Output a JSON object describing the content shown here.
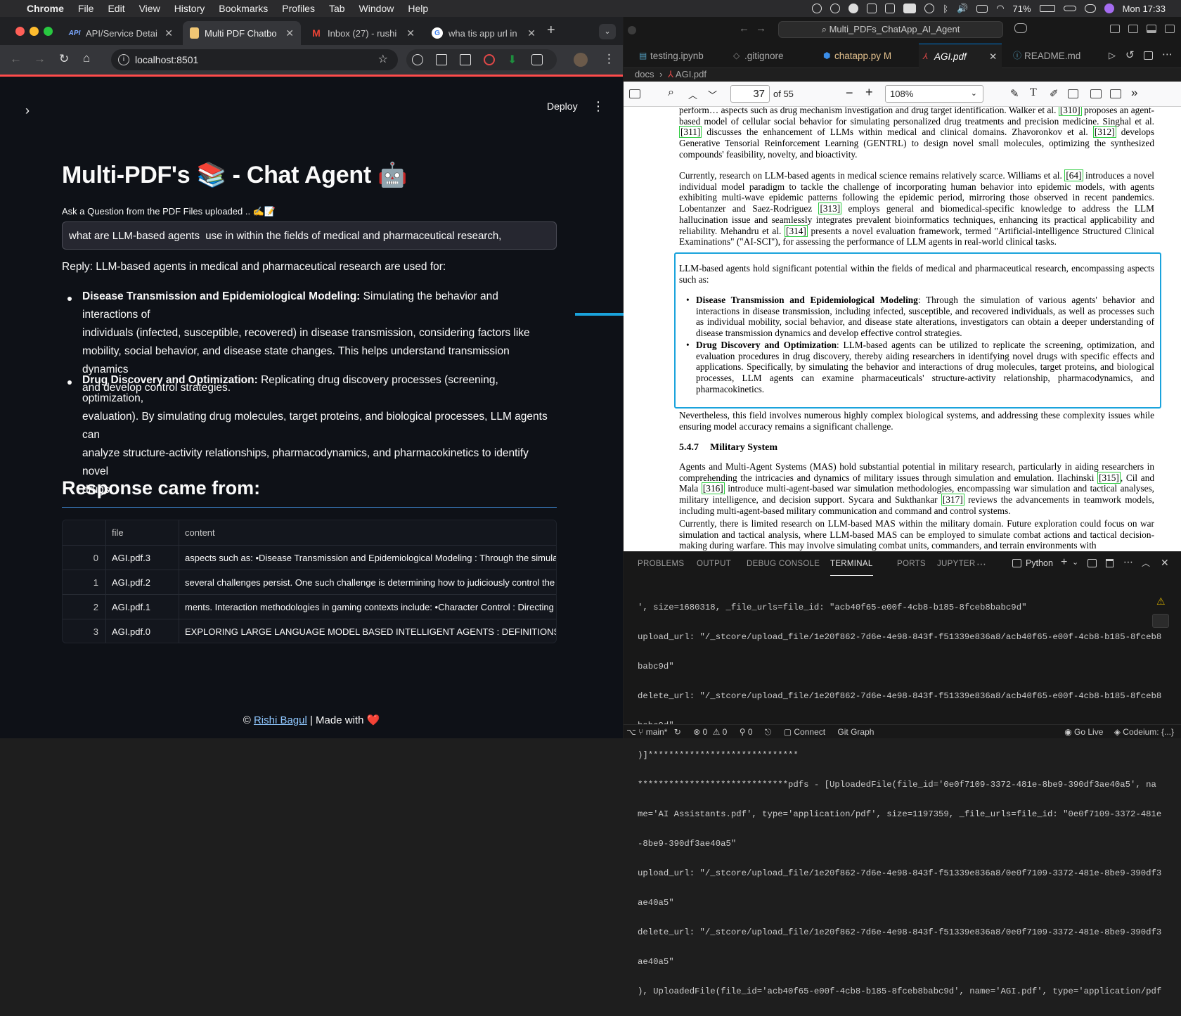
{
  "menubar": {
    "app": "Chrome",
    "items": [
      "File",
      "Edit",
      "View",
      "History",
      "Bookmarks",
      "Profiles",
      "Tab",
      "Window",
      "Help"
    ],
    "battery": "71%",
    "clock": "Mon 17:33"
  },
  "chrome": {
    "tabs": [
      {
        "title": "API/Service Detai",
        "favicon": "API"
      },
      {
        "title": "Multi PDF Chatbo",
        "favicon": "doc"
      },
      {
        "title": "Inbox (27) - rushi",
        "favicon": "M"
      },
      {
        "title": "wha tis app url in",
        "favicon": "G"
      }
    ],
    "url": "localhost:8501"
  },
  "streamlit": {
    "deploy": "Deploy",
    "title": "Multi-PDF's 📚 - Chat Agent 🤖",
    "question_label": "Ask a Question from the PDF Files uploaded .. ✍️📝",
    "question_value": "what are LLM-based agents  use in within the fields of medical and pharmaceutical research,",
    "reply_intro": "Reply: LLM-based agents in medical and pharmaceutical research are used for:",
    "bullets": [
      {
        "bold": "Disease Transmission and Epidemiological Modeling:",
        "lines": [
          "Simulating the behavior and interactions of",
          "individuals (infected, susceptible, recovered) in disease transmission, considering factors like",
          "mobility, social behavior, and disease state changes. This helps understand transmission dynamics",
          "and develop control strategies."
        ]
      },
      {
        "bold": "Drug Discovery and Optimization:",
        "lines": [
          "Replicating drug discovery processes (screening, optimization,",
          "evaluation). By simulating drug molecules, target proteins, and biological processes, LLM agents can",
          "analyze structure-activity relationships, pharmacodynamics, and pharmacokinetics to identify novel",
          "drugs."
        ]
      }
    ],
    "response_header": "Response came from:",
    "table": {
      "columns": [
        "",
        "file",
        "content"
      ],
      "rows": [
        [
          "0",
          "AGI.pdf.3",
          "aspects such as: •Disease Transmission and Epidemiological Modeling : Through the simula"
        ],
        [
          "1",
          "AGI.pdf.2",
          "several challenges persist. One such challenge is determining how to judiciously control the"
        ],
        [
          "2",
          "AGI.pdf.1",
          "ments. Interaction methodologies in gaming contexts include: •Character Control : Directing"
        ],
        [
          "3",
          "AGI.pdf.0",
          "EXPLORING LARGE LANGUAGE MODEL BASED INTELLIGENT AGENTS : DEFINITIONS , METHO"
        ]
      ]
    },
    "footer_prefix": "© ",
    "footer_link": "Rishi Bagul",
    "footer_suffix": " | Made with ❤️"
  },
  "vscode": {
    "search": "Multi_PDFs_ChatApp_AI_Agent",
    "tabs": [
      {
        "name": "testing.ipynb",
        "icon": "notebook-icon"
      },
      {
        "name": ".gitignore",
        "icon": "gitignore-icon"
      },
      {
        "name": "chatapp.py",
        "badge": "M",
        "icon": "python-icon"
      },
      {
        "name": "AGI.pdf",
        "icon": "pdf-icon"
      },
      {
        "name": "README.md",
        "icon": "info-icon"
      }
    ],
    "breadcrumb": [
      "docs",
      "AGI.pdf"
    ],
    "pdf": {
      "page": "37",
      "of": "of 55",
      "zoom": "108%"
    },
    "panel_tabs": [
      "PROBLEMS",
      "OUTPUT",
      "DEBUG CONSOLE",
      "TERMINAL",
      "PORTS",
      "JUPYTER"
    ],
    "terminal_label": "Python",
    "terminal_lines": [
      "', size=1680318, _file_urls=file_id: \"acb40f65-e00f-4cb8-b185-8fceb8babc9d\"",
      "upload_url: \"/_stcore/upload_file/1e20f862-7d6e-4e98-843f-f51339e836a8/acb40f65-e00f-4cb8-b185-8fceb8",
      "babc9d\"",
      "delete_url: \"/_stcore/upload_file/1e20f862-7d6e-4e98-843f-f51339e836a8/acb40f65-e00f-4cb8-b185-8fceb8",
      "babc9d\"",
      ")]*****************************",
      "*****************************pdfs - [UploadedFile(file_id='0e0f7109-3372-481e-8be9-390df3ae40a5', na",
      "me='AI Assistants.pdf', type='application/pdf', size=1197359, _file_urls=file_id: \"0e0f7109-3372-481e",
      "-8be9-390df3ae40a5\"",
      "upload_url: \"/_stcore/upload_file/1e20f862-7d6e-4e98-843f-f51339e836a8/0e0f7109-3372-481e-8be9-390df3",
      "ae40a5\"",
      "delete_url: \"/_stcore/upload_file/1e20f862-7d6e-4e98-843f-f51339e836a8/0e0f7109-3372-481e-8be9-390df3",
      "ae40a5\"",
      "), UploadedFile(file_id='acb40f65-e00f-4cb8-b185-8fceb8babc9d', name='AGI.pdf', type='application/pdf"
    ],
    "status": {
      "branch": "main*",
      "errors": "0",
      "warnings": "0",
      "ports": "0",
      "connect": "Connect",
      "git_graph": "Git Graph",
      "go_live": "Go Live",
      "codeium": "Codeium: {...}"
    }
  },
  "pdf_text": {
    "p1a": "aspects such as drug mechanism investigation and drug target identification. Walker et al. ",
    "r310": "[310]",
    "p1b": " proposes an agent-based model of cellular social behavior for simulating personalized drug treatments and precision medicine. Singhal et al. ",
    "r311": "[311]",
    "p1c": " discusses the enhancement of LLMs within medical and clinical domains. Zhavoronkov et al. ",
    "r312": "[312]",
    "p1d": " develops Generative Tensorial Reinforcement Learning (GENTRL) to design novel small molecules, optimizing the synthesized compounds' feasibility, novelty, and bioactivity.",
    "p2a": "Currently, research on LLM-based agents in medical science remains relatively scarce. Williams et al. ",
    "r64": "[64]",
    "p2b": " introduces a novel individual model paradigm to tackle the challenge of incorporating human behavior into epidemic models, with agents exhibiting multi-wave epidemic patterns following the epidemic period, mirroring those observed in recent pandemics. Lobentanzer and Saez-Rodriguez ",
    "r313": "[313]",
    "p2c": " employs general and biomedical-specific knowledge to address the LLM hallucination issue and seamlessly integrates prevalent bioinformatics techniques, enhancing its practical applicability and reliability. Mehandru et al. ",
    "r314": "[314]",
    "p2d": " presents a novel evaluation framework, termed \"Artificial-intelligence Structured Clinical Examinations\" (\"AI-SCI\"), for assessing the performance of LLM agents in real-world clinical tasks.",
    "p3": "LLM-based agents hold significant potential within the fields of medical and pharmaceutical research, encompassing aspects such as:",
    "b1h": "Disease Transmission and Epidemiological Modeling",
    "b1": ": Through the simulation of various agents' behavior and interactions in disease transmission, including infected, susceptible, and recovered individuals, as well as processes such as individual mobility, social behavior, and disease state alterations, investigators can obtain a deeper understanding of disease transmission dynamics and develop effective control strategies.",
    "b2h": "Drug Discovery and Optimization",
    "b2": ": LLM-based agents can be utilized to replicate the screening, optimization, and evaluation procedures in drug discovery, thereby aiding researchers in identifying novel drugs with specific effects and applications. Specifically, by simulating the behavior and interactions of drug molecules, target proteins, and biological processes, LLM agents can examine pharmaceuticals' structure-activity relationship, pharmacodynamics, and pharmacokinetics.",
    "p4": "Nevertheless, this field involves numerous highly complex biological systems, and addressing these complexity issues while ensuring model accuracy remains a significant challenge.",
    "h_num": "5.4.7",
    "h_title": "Military System",
    "p5a": "Agents and Multi-Agent Systems (MAS) hold substantial potential in military research, particularly in aiding researchers in comprehending the intricacies and dynamics of military issues through simulation and emulation. Ilachinski ",
    "r315": "[315]",
    "p5b": ", Cil and Mala ",
    "r316": "[316]",
    "p5c": " introduce multi-agent-based war simulation methodologies, encompassing war simulation and tactical analyses, military intelligence, and decision support. Sycara and Sukthankar ",
    "r317": "[317]",
    "p5d": " reviews the advancements in teamwork models, including multi-agent-based military communication and command and control systems.",
    "p6": "Currently, there is limited research on LLM-based MAS within the military domain. Future exploration could focus on war simulation and tactical analysis, where LLM-based MAS can be employed to simulate combat actions and tactical decision-making during warfare. This may involve simulating combat units, commanders, and terrain environments with"
  }
}
